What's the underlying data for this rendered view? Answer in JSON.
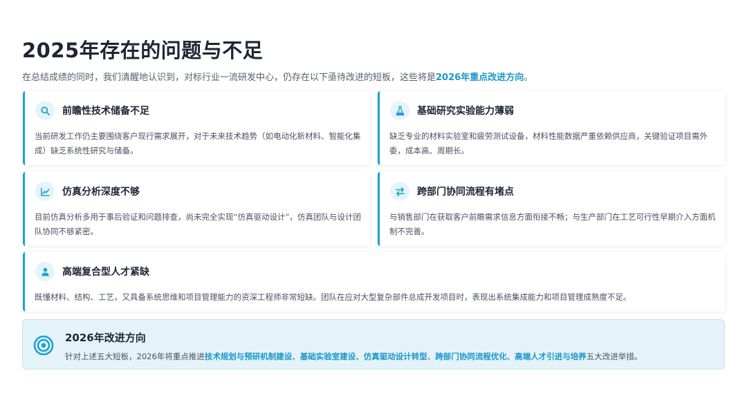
{
  "page": {
    "title": "2025年存在的问题与不足",
    "subtitle_prefix": "在总结成绩的同时，我们清醒地认识到，对标行业一流研发中心，仍存在以下亟待改进的短板，这些将是",
    "subtitle_highlight": "2026年重点改进方向",
    "subtitle_suffix": "。"
  },
  "colors": {
    "accent": "#1ba2cf",
    "highlight_text": "#1a97c9",
    "icon_bg": "#e6f4fa",
    "summary_bg": "#e4f3fa"
  },
  "cards": [
    {
      "icon": "search-icon",
      "title": "前瞻性技术储备不足",
      "desc": "当前研发工作仍主要围绕客户现行需求展开，对于未来技术趋势（如电动化新材料、智能化集成）缺乏系统性研究与储备。"
    },
    {
      "icon": "flask-icon",
      "title": "基础研究实验能力薄弱",
      "desc": "缺乏专业的材料实验室和疲劳测试设备，材料性能数据严重依赖供应商，关键验证项目需外委，成本高、周期长。"
    },
    {
      "icon": "chart-line-icon",
      "title": "仿真分析深度不够",
      "desc": "目前仿真分析多用于事后验证和问题排查，尚未完全实现“仿真驱动设计”，仿真团队与设计团队协同不够紧密。"
    },
    {
      "icon": "exchange-icon",
      "title": "跨部门协同流程有堵点",
      "desc": "与销售部门在获取客户前瞻需求信息方面衔接不畅；与生产部门在工艺可行性早期介入方面机制不完善。"
    },
    {
      "icon": "user-icon",
      "title": "高端复合型人才紧缺",
      "desc": "既懂材料、结构、工艺，又具备系统思维和项目管理能力的资深工程师非常短缺。团队在应对大型复杂部件总成开发项目时，表现出系统集成能力和项目管理成熟度不足。"
    }
  ],
  "summary": {
    "icon": "target-icon",
    "title": "2026年改进方向",
    "desc_prefix": "针对上述五大短板，2026年将重点推进",
    "items": [
      "技术规划与预研机制建设",
      "基础实验室建设",
      "仿真驱动设计转型",
      "跨部门协同流程优化",
      "高端人才引进与培养"
    ],
    "separator": "、",
    "desc_suffix": "五大改进举措。"
  }
}
